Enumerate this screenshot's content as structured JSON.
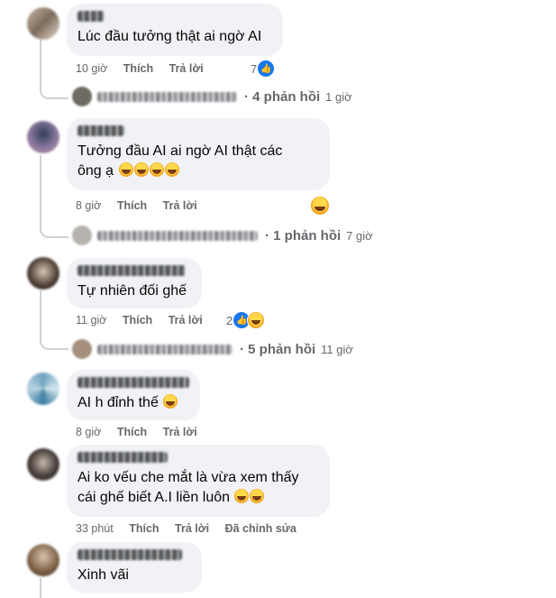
{
  "comments": [
    {
      "text": "Lúc đầu tưởng thật ai ngờ AI",
      "time": "10 giờ",
      "like": "Thích",
      "reply": "Trả lời",
      "reaction_count": "7",
      "replies": {
        "count_label": "· 4 phản hồi",
        "time": "1 giờ"
      }
    },
    {
      "text_line1": "Tưởng đầu AI ai ngờ AI thật các",
      "text_line2": "ông ạ",
      "time": "8 giờ",
      "like": "Thích",
      "reply": "Trả lời",
      "replies": {
        "count_label": "· 1 phản hồi",
        "time": "7 giờ"
      }
    },
    {
      "text": "Tự nhiên đối ghế",
      "time": "11 giờ",
      "like": "Thích",
      "reply": "Trả lời",
      "reaction_count": "2",
      "replies": {
        "count_label": "· 5 phản hồi",
        "time": "11 giờ"
      }
    },
    {
      "text": "AI h đỉnh thế",
      "time": "8 giờ",
      "like": "Thích",
      "reply": "Trả lời"
    },
    {
      "text_line1": "Ai ko vếu che mắt là vừa xem thấy",
      "text_line2": "cái ghế biết A.I liền luôn",
      "time": "33 phút",
      "like": "Thích",
      "reply": "Trả lời",
      "edited": "Đã chỉnh sửa"
    },
    {
      "text": "Xinh vãi"
    }
  ],
  "colors": {
    "bubble": "#f0f2f5",
    "like_blue": "#1877f2",
    "meta_gray": "#65676b"
  }
}
